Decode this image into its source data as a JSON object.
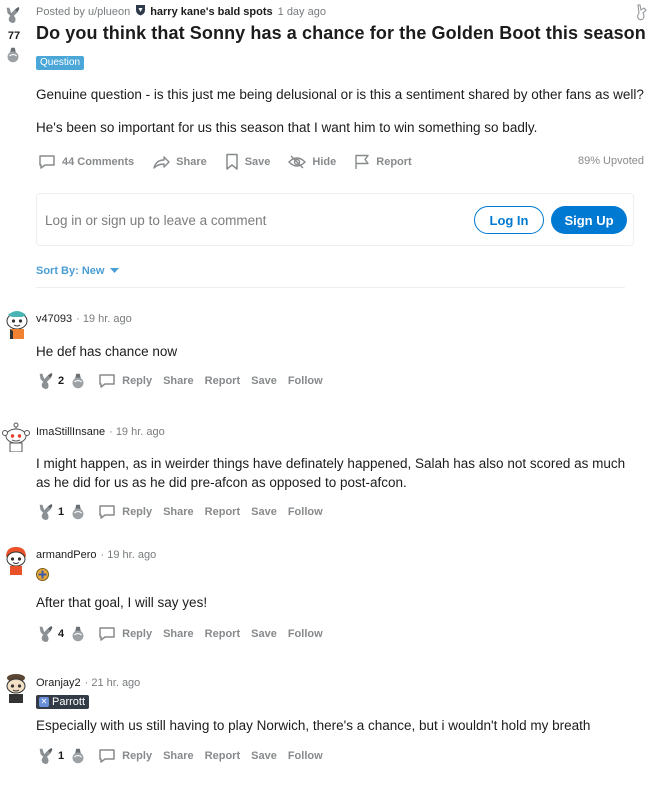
{
  "post": {
    "score": "77",
    "posted_by": "Posted by u/plueon",
    "user_flair": "harry kane's bald spots",
    "time": "1 day ago",
    "title": "Do you think that Sonny has a chance for the Golden Boot this season?",
    "tag": "Question",
    "body": [
      "Genuine question - is this just me being delusional or is this a sentiment shared by other fans as well?",
      "He's been so important for us this season that I want him to win something so badly."
    ],
    "actions": {
      "comments": "44 Comments",
      "share": "Share",
      "save": "Save",
      "hide": "Hide",
      "report": "Report"
    },
    "upvoted": "89% Upvoted"
  },
  "login": {
    "prompt": "Log in or sign up to leave a comment",
    "login_label": "Log In",
    "signup_label": "Sign Up"
  },
  "sort": {
    "label": "Sort By: New"
  },
  "comments": [
    {
      "user": "v47093",
      "time": "· 19 hr. ago",
      "text": "He def has chance now",
      "votes": "2"
    },
    {
      "user": "ImaStillInsane",
      "time": "· 19 hr. ago",
      "text": "I might happen, as in weirder things have definately happened, Salah has also not scored as much as he did for us as he did pre-afcon as opposed to post-afcon.",
      "votes": "1"
    },
    {
      "user": "armandPero",
      "time": "· 19 hr. ago",
      "text": "After that goal, I will say yes!",
      "votes": "4"
    },
    {
      "user": "Oranjay2",
      "time": "· 21 hr. ago",
      "flair": "Parrott",
      "text": "Especially with us still having to play Norwich, there's a chance, but i wouldn't hold my breath",
      "votes": "1"
    }
  ],
  "comment_actions": {
    "reply": "Reply",
    "share": "Share",
    "report": "Report",
    "save": "Save",
    "follow": "Follow"
  },
  "colors": {
    "accent": "#0079d3",
    "tag": "#4aa7d8",
    "sort": "#4a9ed4",
    "muted": "#878a8c"
  }
}
